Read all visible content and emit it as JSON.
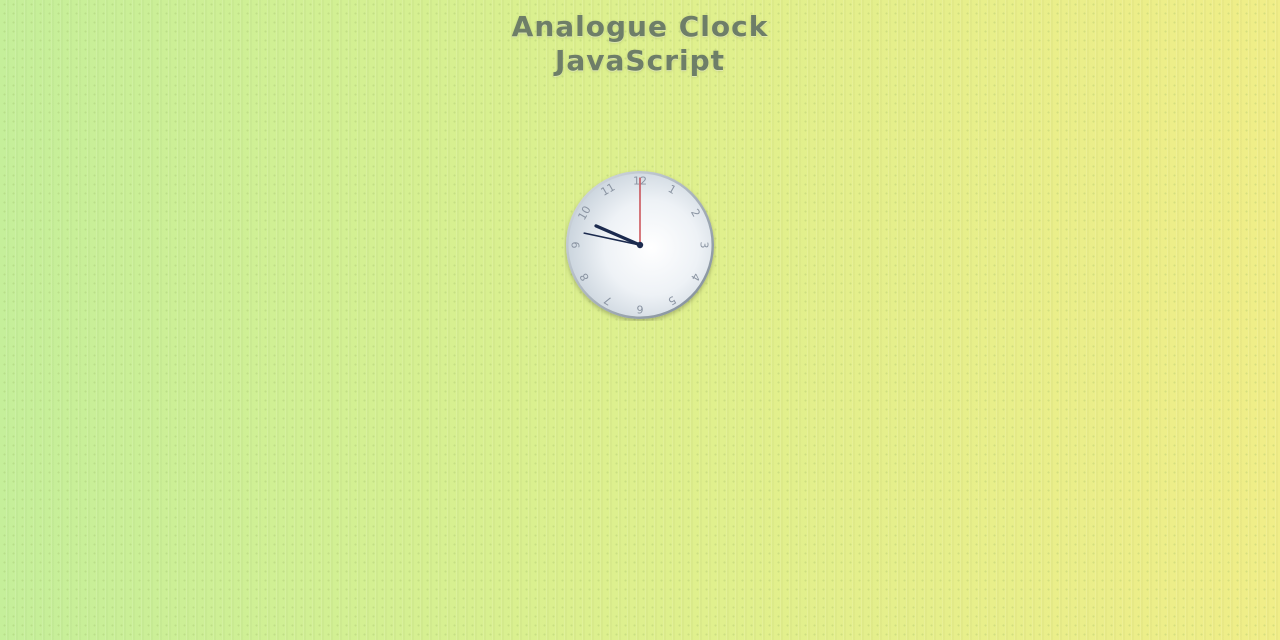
{
  "page": {
    "title_line1": "Analogue Clock",
    "title_line2": "JavaScript"
  },
  "clock": {
    "numerals": [
      "12",
      "1",
      "2",
      "3",
      "4",
      "5",
      "6",
      "7",
      "8",
      "9",
      "10",
      "11"
    ],
    "time": {
      "hours": 9,
      "minutes": 47,
      "seconds": 0
    },
    "colors": {
      "hour_hand": "#1b2a4e",
      "minute_hand": "#1b2a4e",
      "second_hand": "#c0242b",
      "numerals": "#8a94a2"
    }
  }
}
